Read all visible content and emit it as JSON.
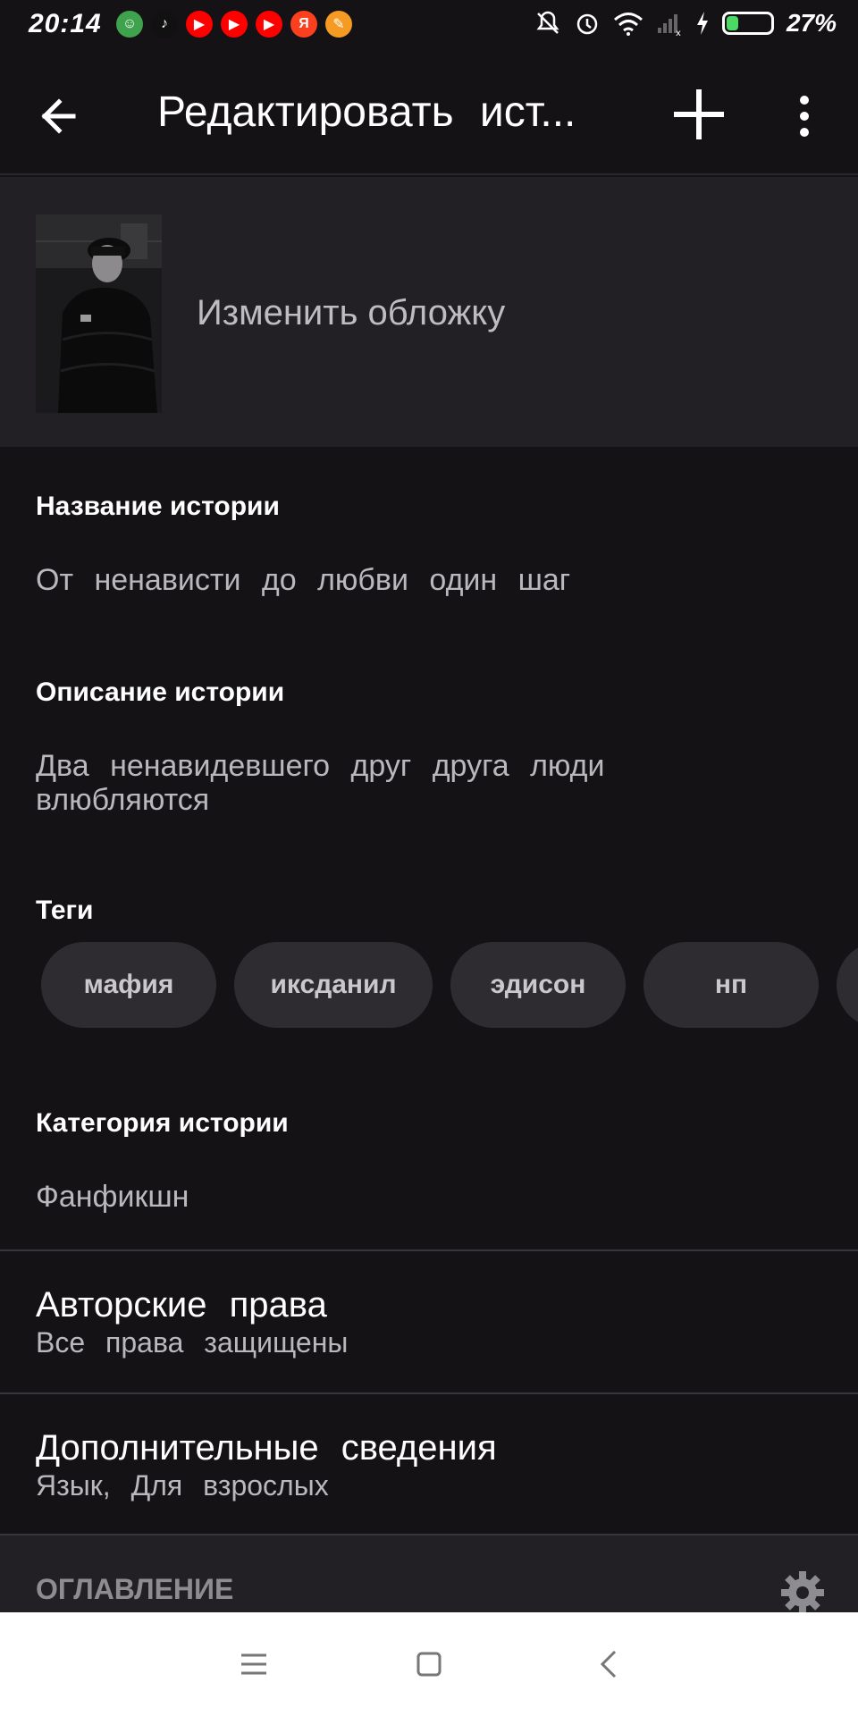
{
  "status_bar": {
    "time": "20:14",
    "battery_percent": "27%",
    "battery_level": 0.27,
    "apps": [
      {
        "icon": "cat-app-icon",
        "color": "#3fa34d",
        "glyph": "☺"
      },
      {
        "icon": "tiktok-icon",
        "color": "#111111",
        "glyph": "♪"
      },
      {
        "icon": "youtube-icon",
        "color": "#ff0000",
        "glyph": "▶"
      },
      {
        "icon": "youtube-icon",
        "color": "#ff0000",
        "glyph": "▶"
      },
      {
        "icon": "youtube-icon",
        "color": "#ff0000",
        "glyph": "▶"
      },
      {
        "icon": "yandex-icon",
        "color": "#fc3f1d",
        "glyph": "Я"
      },
      {
        "icon": "broom-app-icon",
        "color": "#f59a23",
        "glyph": "✎"
      }
    ]
  },
  "toolbar": {
    "title": "Редактировать ист..."
  },
  "cover": {
    "label": "Изменить обложку"
  },
  "story_title": {
    "label": "Название истории",
    "value": "От ненависти до любви один шаг"
  },
  "story_description": {
    "label": "Описание истории",
    "value": "Два ненавидевшего друг друга люди влюбляются"
  },
  "tags": {
    "label": "Теги",
    "items": [
      "мафия",
      "иксданил",
      "эдисон",
      "нп",
      ""
    ]
  },
  "category": {
    "label": "Категория истории",
    "value": "Фанфикшн"
  },
  "copyright": {
    "title": "Авторские права",
    "value": "Все права защищены"
  },
  "extra_info": {
    "title": "Дополнительные сведения",
    "value": "Язык, Для взрослых"
  },
  "toc": {
    "label": "ОГЛАВЛЕНИЕ"
  },
  "colors": {
    "background": "#141215",
    "surface": "#222024",
    "tag_bg": "#2e2c30",
    "battery": "#4cd964"
  }
}
